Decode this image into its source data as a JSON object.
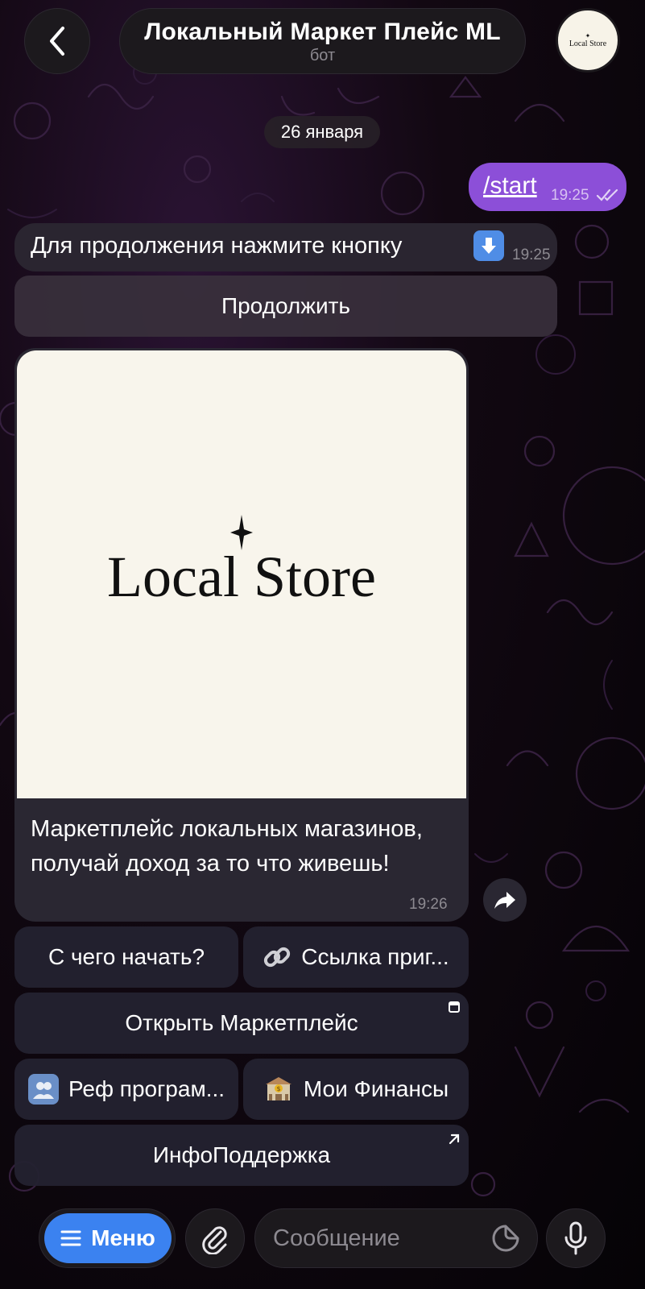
{
  "header": {
    "title": "Локальный Маркет Плейс ML",
    "subtitle": "бот",
    "avatar_lines": [
      "Local Store"
    ]
  },
  "chat": {
    "date_label": "26 января",
    "outgoing": {
      "text": "/start",
      "time": "19:25"
    },
    "message1": {
      "text": "Для продолжения нажмите кнопку",
      "time": "19:25",
      "emoji": "down-arrow-button"
    },
    "continue_button": "Продолжить",
    "post": {
      "logo_text": "Local Store",
      "caption": "Маркетплейс локальных магазинов, получай доход за то что живешь!",
      "time": "19:26"
    },
    "keyboard": {
      "start_help": "С чего начать?",
      "invite_link": "Ссылка приг...",
      "open_marketplace": "Открыть Маркетплейс",
      "ref_program": "Реф програм...",
      "my_finances": "Мои Финансы",
      "info_support": "ИнфоПоддержка"
    }
  },
  "bottom_bar": {
    "menu_label": "Меню",
    "input_placeholder": "Сообщение"
  },
  "colors": {
    "outgoing_bubble": "#8c4fd8",
    "menu_button": "#3b82f0",
    "incoming_bubble": "#2a2530"
  }
}
